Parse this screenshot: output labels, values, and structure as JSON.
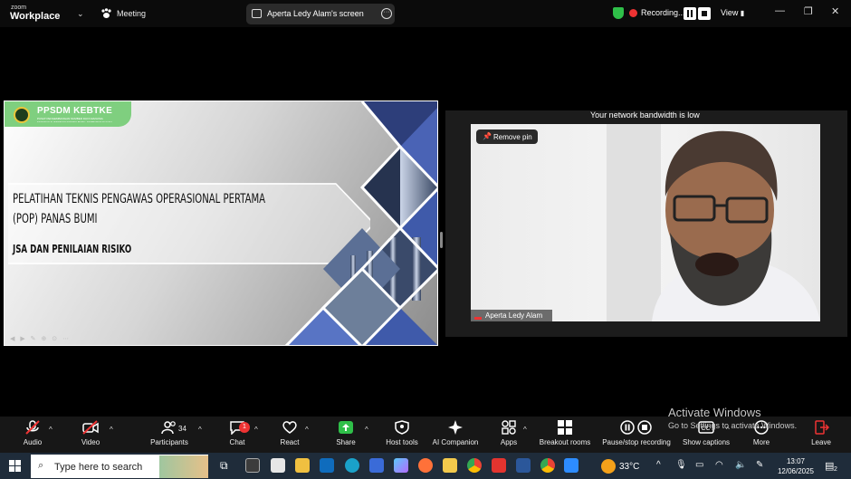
{
  "app": {
    "logo_top": "zoom",
    "logo_main": "Workplace",
    "meeting_label": "Meeting"
  },
  "share_indicator": {
    "label": "Aperta Ledy Alam's screen",
    "more": "···"
  },
  "recording": {
    "label": "Recording...",
    "status_color": "#2fbf49"
  },
  "view": {
    "label": "View"
  },
  "window_controls": [
    "—",
    "❐",
    "✕"
  ],
  "slide": {
    "org_title": "PPSDM KEBTKE",
    "org_subtitle": "PUSAT PENGEMBANGAN SUMBER DAYA MANUSIA KETENAGALISTRIKAN ENERGI BARU, TERBARUKAN DAN KONSERVASI ENERGI",
    "title_line1": "PELATIHAN TEKNIS PENGAWAS OPERASIONAL PERTAMA",
    "title_line2": "(POP) PANAS BUMI",
    "subtitle": "JSA DAN PENILAIAN RISIKO",
    "banner_color": "#7fcf7f"
  },
  "video": {
    "network_message": "Your network bandwidth is low",
    "pin_button": "Remove pin",
    "participant_name": "Aperta Ledy Alam"
  },
  "toolbar": {
    "audio": "Audio",
    "video": "Video",
    "participants": "Participants",
    "participants_count": "34",
    "chat": "Chat",
    "chat_badge": "1",
    "react": "React",
    "share": "Share",
    "host_tools": "Host tools",
    "ai_companion": "AI Companion",
    "apps": "Apps",
    "breakout_rooms": "Breakout rooms",
    "pause_recording": "Pause/stop recording",
    "show_captions": "Show captions",
    "more": "More",
    "leave": "Leave",
    "leave_color": "#e33333",
    "share_color": "#2fbf49"
  },
  "watermark": {
    "line1": "Activate Windows",
    "line2": "Go to Settings to activate Windows."
  },
  "taskbar": {
    "search_placeholder": "Type here to search",
    "temperature": "33°C",
    "time": "13:07",
    "date": "12/06/2025",
    "notification_count": "2"
  }
}
